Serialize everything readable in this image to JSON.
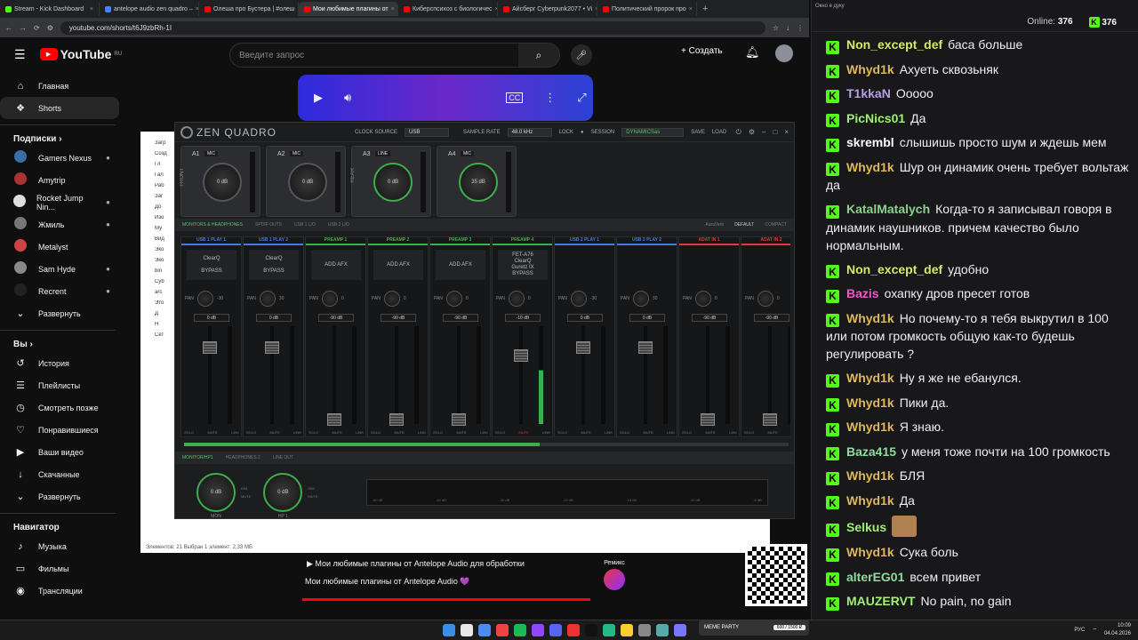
{
  "browser": {
    "tabs": [
      {
        "title": "Stream - Kick Dashboard",
        "color": "#53fc18",
        "active": false
      },
      {
        "title": "antelope audio zen quadro –",
        "color": "#4285f4",
        "active": false
      },
      {
        "title": "Олеша про Бустера | #олеш",
        "color": "#ff0000",
        "active": false
      },
      {
        "title": "Мои любимые плагины от",
        "color": "#ff0000",
        "active": true
      },
      {
        "title": "Киберспсихоз с биологичес",
        "color": "#ff0000",
        "active": false
      },
      {
        "title": "Айсберг Cyberpunk2077 • Vi",
        "color": "#ff0000",
        "active": false
      },
      {
        "title": "Политический пророк про",
        "color": "#ff0000",
        "active": false
      }
    ],
    "new_tab": "+",
    "url": "youtube.com/shorts/t6J9zbRh-1I"
  },
  "youtube": {
    "logo_text": "YouTube",
    "logo_region": "RU",
    "search_placeholder": "Введите запрос",
    "create_label": "+ Создать",
    "nav_main": [
      {
        "label": "Главная",
        "icon": "⌂"
      },
      {
        "label": "Shorts",
        "icon": "❖"
      }
    ],
    "subs_title": "Подписки ›",
    "subscriptions": [
      {
        "label": "Gamers Nexus",
        "color": "#3a6ea5",
        "dot": true
      },
      {
        "label": "Amytrip",
        "color": "#a33",
        "dot": false
      },
      {
        "label": "Rocket Jump Nin...",
        "color": "#ddd",
        "dot": true
      },
      {
        "label": "Жмиль",
        "color": "#777",
        "dot": true
      },
      {
        "label": "Metalyst",
        "color": "#c44",
        "dot": false
      },
      {
        "label": "Sam Hyde",
        "color": "#888",
        "dot": true
      },
      {
        "label": "Recrent",
        "color": "#222",
        "dot": true
      }
    ],
    "subs_expand": "Развернуть",
    "you_title": "Вы ›",
    "you_items": [
      {
        "label": "История",
        "icon": "↺"
      },
      {
        "label": "Плейлисты",
        "icon": "☰"
      },
      {
        "label": "Смотреть позже",
        "icon": "◷"
      },
      {
        "label": "Понравившиеся",
        "icon": "♡"
      },
      {
        "label": "Ваши видео",
        "icon": "▶"
      },
      {
        "label": "Скачанные",
        "icon": "↓"
      },
      {
        "label": "Развернуть",
        "icon": "⌄"
      }
    ],
    "nav_title": "Навигатор",
    "nav_items": [
      {
        "label": "Музыка",
        "icon": "♪"
      },
      {
        "label": "Фильмы",
        "icon": "▭"
      },
      {
        "label": "Трансляции",
        "icon": "◉"
      }
    ],
    "video_title_1": "Мои любимые плагины от Antelope Audio для обработки",
    "video_title_2": "Мои любимые плагины от Antelope Audio 💜",
    "remix_label": "Ремикс"
  },
  "explorer": {
    "side_items": [
      "Загр",
      "Созд",
      "Гл",
      "Гал",
      "Раб",
      "Заг",
      "До",
      "Изо",
      "Му",
      "Вид",
      "Эко",
      "Эко",
      "bin",
      "Cyb",
      "arc",
      "Это",
      "Д",
      "Н",
      "Сет"
    ],
    "status": "Элементов: 21     Выбран 1 элемент: 2,33 МБ"
  },
  "zen": {
    "logo": "ZEN QUADRO",
    "clock_label": "CLOCK SOURCE",
    "clock_value": "USB",
    "rate_label": "SAMPLE RATE",
    "rate_value": "48.0 kHz",
    "lock_label": "LOCK",
    "session_label": "SESSION",
    "session_value": "DYNAMICSas",
    "save": "SAVE",
    "load": "LOAD",
    "front": "FRONT",
    "rear": "REAR",
    "preamps": [
      {
        "name": "A1",
        "source": "MIC",
        "gain": "0 dB",
        "active": false
      },
      {
        "name": "A2",
        "source": "MIC",
        "gain": "0 dB",
        "active": false
      },
      {
        "name": "A3",
        "source": "LINE",
        "gain": "0 dB",
        "active": true
      },
      {
        "name": "A4",
        "source": "MIC",
        "gain": "35 dB",
        "active": true
      }
    ],
    "bar1": [
      "MONITORS & HEADPHONES",
      "SPDIF OUTS",
      "USB 1 L/O",
      "USB 2 L/O"
    ],
    "aura": "AuraVerb",
    "view_default": "DEFAULT",
    "view_compact": "COMPACT",
    "channels": [
      {
        "name": "USB 1 PLAY 1",
        "color": "#4a7bd8",
        "afx": "ClearQ\n\nBYPASS",
        "pan": "-30",
        "db": "0 dB",
        "fader": 0.78,
        "level": 0.0,
        "mute_red": false
      },
      {
        "name": "USB 1 PLAY 2",
        "color": "#4a7bd8",
        "afx": "ClearQ\n\nBYPASS",
        "pan": "30",
        "db": "0 dB",
        "fader": 0.78,
        "level": 0.0,
        "mute_red": false
      },
      {
        "name": "PREAMP 1",
        "color": "#3cae4b",
        "afx": "ADD AFX",
        "pan": "0",
        "db": "-90 dB",
        "fader": 0.05,
        "level": 0.0,
        "mute_red": false
      },
      {
        "name": "PREAMP 2",
        "color": "#3cae4b",
        "afx": "ADD AFX",
        "pan": "0",
        "db": "-90 dB",
        "fader": 0.05,
        "level": 0.0,
        "mute_red": false
      },
      {
        "name": "PREAMP 3",
        "color": "#3cae4b",
        "afx": "ADD AFX",
        "pan": "0",
        "db": "-90 dB",
        "fader": 0.05,
        "level": 0.0,
        "mute_red": false
      },
      {
        "name": "PREAMP 4",
        "color": "#3cae4b",
        "afx": "FET-A76\nClearQ\nGuretz IX\nBYPASS",
        "pan": "0",
        "db": "-10 dB",
        "fader": 0.7,
        "level": 0.55,
        "mute_red": true
      },
      {
        "name": "USB 2 PLAY 1",
        "color": "#4a7bd8",
        "afx": "",
        "pan": "-30",
        "db": "0 dB",
        "fader": 0.78,
        "level": 0.0,
        "mute_red": false
      },
      {
        "name": "USB 2 PLAY 2",
        "color": "#4a7bd8",
        "afx": "",
        "pan": "30",
        "db": "0 dB",
        "fader": 0.78,
        "level": 0.0,
        "mute_red": false
      },
      {
        "name": "ADAT IN 1",
        "color": "#e03a3a",
        "afx": "",
        "pan": "0",
        "db": "-90 dB",
        "fader": 0.05,
        "level": 0.0,
        "mute_red": false
      },
      {
        "name": "ADAT IN 2",
        "color": "#e03a3a",
        "afx": "",
        "pan": "0",
        "db": "-90 dB",
        "fader": 0.05,
        "level": 0.0,
        "mute_red": false
      }
    ],
    "foot": [
      "SOLO",
      "MUTE",
      "LINK"
    ],
    "bar2": [
      "MONITOR/HP1",
      "HEADPHONES 2",
      "LINE OUT"
    ],
    "monitors": [
      {
        "label": "MON",
        "gain": "0 dB"
      },
      {
        "label": "HP 1",
        "gain": "0 dB"
      }
    ],
    "mon_ctl": [
      "DIM",
      "MUTE"
    ],
    "ruler": [
      "-60 dB",
      "-40 dB",
      "-30 dB",
      "-20 dB",
      "-15 dB",
      "-10 dB",
      "-5 dB"
    ]
  },
  "chat": {
    "header": "Окно в дуку",
    "online_label": "Online:",
    "online_value": "376",
    "viewers": "376",
    "messages": [
      {
        "user": "Non_except_def",
        "color": "#d9e86a",
        "text": "баса больше"
      },
      {
        "user": "Whyd1k",
        "color": "#e0b85a",
        "text": "Ахуеть сквозьняк"
      },
      {
        "user": "T1kkaN",
        "color": "#b79ee8",
        "text": "Ооооо"
      },
      {
        "user": "PicNics01",
        "color": "#9ff073",
        "text": "Да"
      },
      {
        "user": "skrembl",
        "color": "#ffffff",
        "text": "слышишь просто шум и ждешь мем"
      },
      {
        "user": "Whyd1k",
        "color": "#e0b85a",
        "text": "Шур он динамик очень требует вольтаж да"
      },
      {
        "user": "KatalMatalych",
        "color": "#8ad28a",
        "text": "Когда-то я записывал говоря в динамик наушников. причем качество было нормальным."
      },
      {
        "user": "Non_except_def",
        "color": "#d9e86a",
        "text": "удобно"
      },
      {
        "user": "Bazis",
        "color": "#e85ac8",
        "text": "охапку дров пресет готов"
      },
      {
        "user": "Whyd1k",
        "color": "#e0b85a",
        "text": "Но почему-то я тебя выкрутил в 100 или потом громкость общую как-то будешь регулировать ?"
      },
      {
        "user": "Whyd1k",
        "color": "#e0b85a",
        "text": "Ну я же не ебанулся."
      },
      {
        "user": "Whyd1k",
        "color": "#e0b85a",
        "text": "Пики да."
      },
      {
        "user": "Whyd1k",
        "color": "#e0b85a",
        "text": "Я знаю."
      },
      {
        "user": "Baza415",
        "color": "#8fdc9a",
        "text": "у меня тоже почти на 100 громкость"
      },
      {
        "user": "Whyd1k",
        "color": "#e0b85a",
        "text": "БЛЯ"
      },
      {
        "user": "Whyd1k",
        "color": "#e0b85a",
        "text": "Да"
      },
      {
        "user": "Selkus",
        "color": "#9ff073",
        "text": "",
        "emote": true
      },
      {
        "user": "Whyd1k",
        "color": "#e0b85a",
        "text": "Сука боль"
      },
      {
        "user": "alterEG01",
        "color": "#8fdc9a",
        "text": "всем привет"
      },
      {
        "user": "MAUZERVT",
        "color": "#9ff073",
        "text": "No pain, no gain"
      }
    ]
  },
  "donation": {
    "label": "MEME PARTY",
    "progress": "600 / 1500 ₽"
  },
  "taskbar": {
    "lang": "РУС",
    "time": "10:09",
    "date": "04.04.2026"
  }
}
